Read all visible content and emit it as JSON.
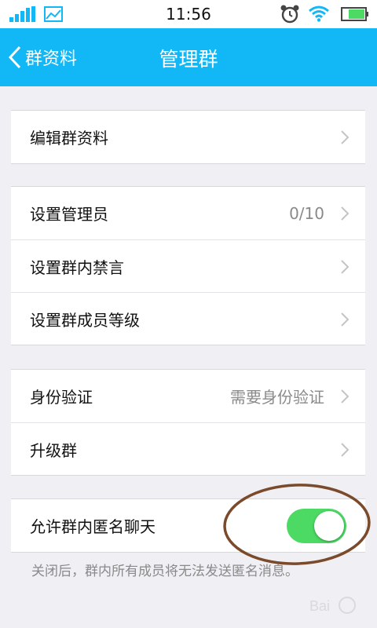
{
  "statusbar": {
    "time": "11:56"
  },
  "navbar": {
    "back_label": "群资料",
    "title": "管理群"
  },
  "groups": {
    "edit": {
      "label": "编辑群资料"
    },
    "admin": [
      {
        "label": "设置管理员",
        "value": "0/10"
      },
      {
        "label": "设置群内禁言"
      },
      {
        "label": "设置群成员等级"
      }
    ],
    "verify": [
      {
        "label": "身份验证",
        "value": "需要身份验证"
      },
      {
        "label": "升级群"
      }
    ],
    "anonymous": {
      "label": "允许群内匿名聊天",
      "enabled": true
    }
  },
  "note": "关闭后，群内所有成员将无法发送匿名消息。",
  "colors": {
    "accent": "#12b7f5",
    "toggle_on": "#4cd964",
    "annotation": "#7a4a2a"
  }
}
